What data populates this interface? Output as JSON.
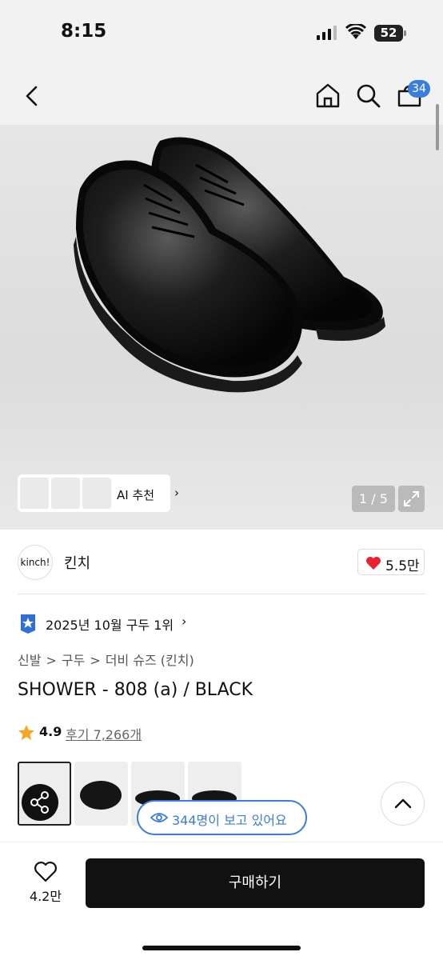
{
  "status_bar": {
    "time": "8:15",
    "battery": "52"
  },
  "nav": {
    "cart_count": "34"
  },
  "gallery": {
    "ai_label": "AI 추천",
    "ai_chevron": "›",
    "page_counter": "1 / 5"
  },
  "shop": {
    "logo_text": "kinch!",
    "name": "킨치",
    "likes": "5.5만"
  },
  "ranking": {
    "text": "2025년 10월 구두 1위",
    "chevron": "›"
  },
  "breadcrumb": [
    "신발",
    ">",
    "구두",
    ">",
    "더비 슈즈 (킨치)"
  ],
  "product": {
    "title": "SHOWER - 808 (a) / BLACK",
    "rating": "4.9",
    "reviews": "후기 7,266개"
  },
  "viewers": {
    "text": "344명이 보고 있어요"
  },
  "bottom_bar": {
    "wish_count": "4.2만",
    "buy_label": "구매하기"
  },
  "colors": {
    "accent": "#3b7ddd",
    "heart": "#e8232f",
    "star": "#f5a623",
    "buy_button": "#111111"
  },
  "icons": [
    "back-icon",
    "home-icon",
    "search-icon",
    "cart-icon",
    "expand-icon",
    "heart-icon",
    "star-icon",
    "rank-badge-icon",
    "share-icon",
    "eye-icon",
    "chevron-up-icon"
  ]
}
